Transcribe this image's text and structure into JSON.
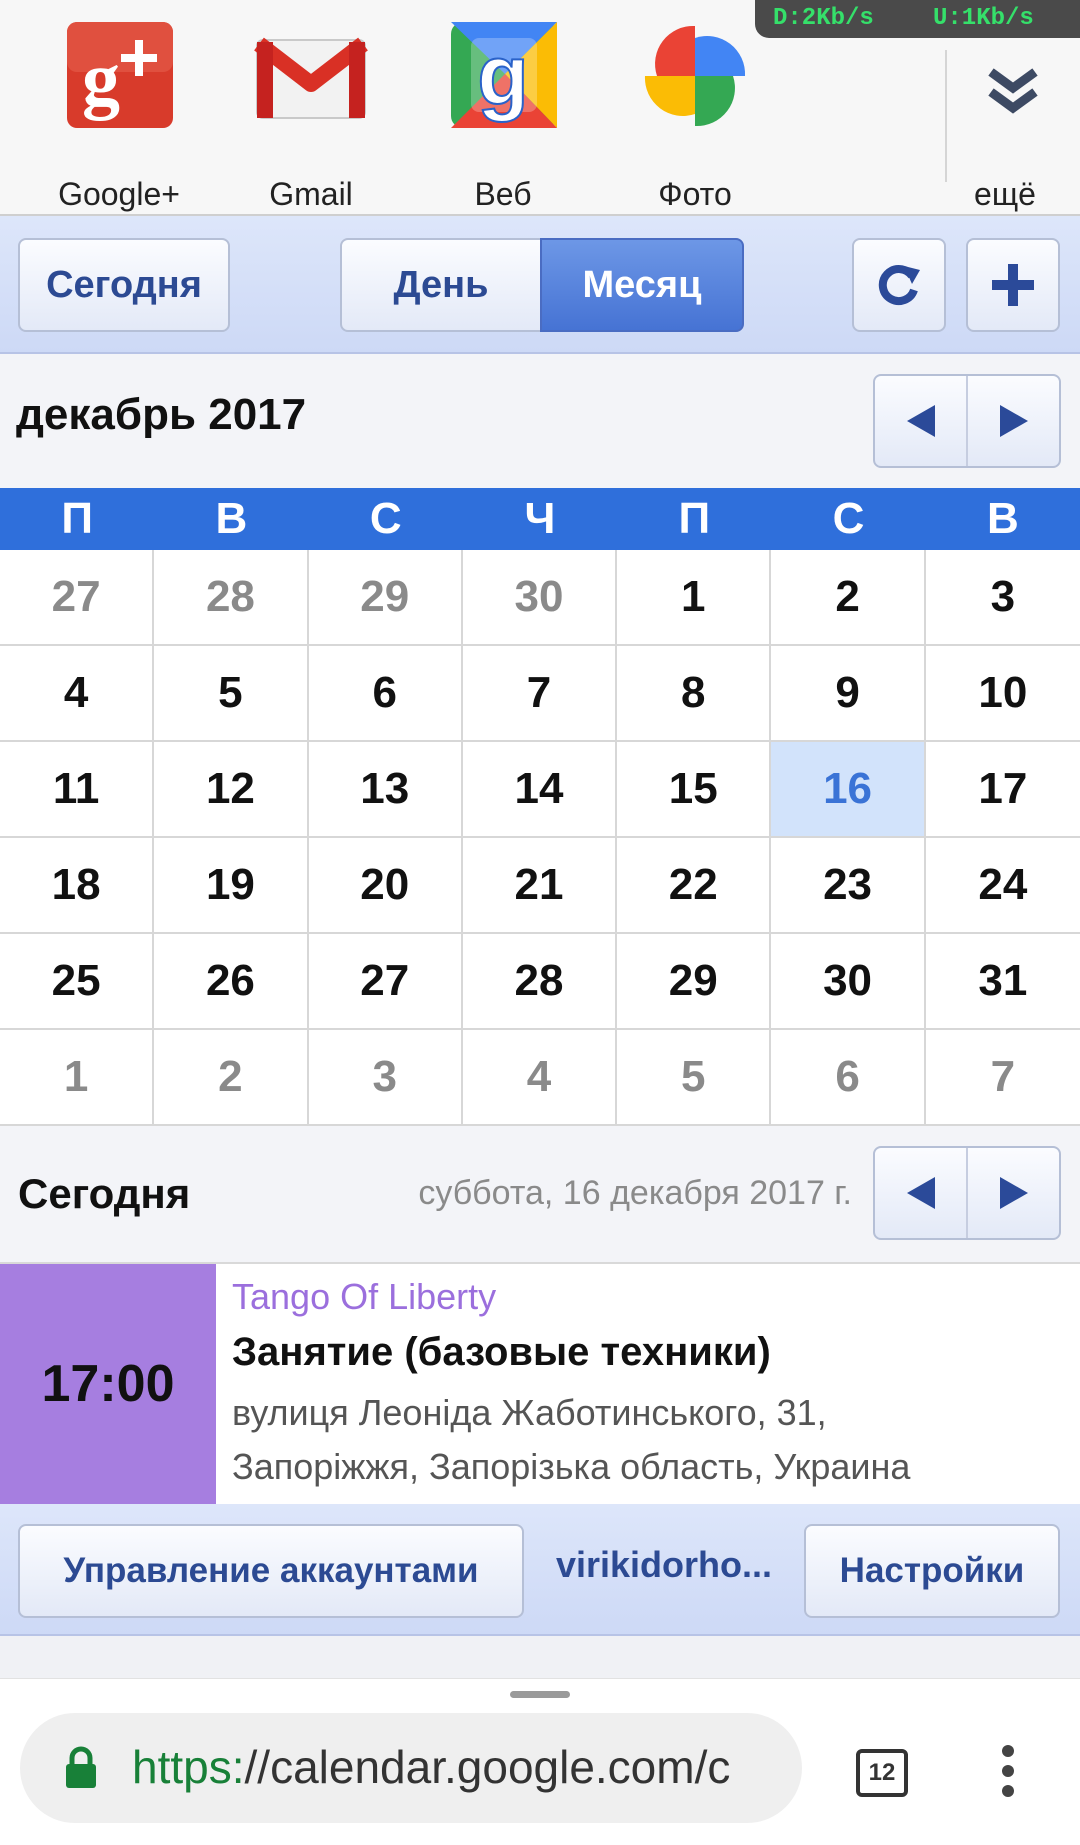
{
  "network_speed": {
    "download": "D:2Kb/s",
    "upload": "U:1Kb/s"
  },
  "apps": [
    {
      "label": "Google+",
      "icon": "google-plus-icon"
    },
    {
      "label": "Gmail",
      "icon": "gmail-icon"
    },
    {
      "label": "Веб",
      "icon": "google-web-icon"
    },
    {
      "label": "Фото",
      "icon": "google-photos-icon"
    }
  ],
  "more_label": "ещё",
  "toolbar": {
    "today": "Сегодня",
    "day": "День",
    "month": "Месяц",
    "refresh_icon": "refresh-icon",
    "add_icon": "plus-icon"
  },
  "month_title": "декабрь 2017",
  "weekdays": [
    "П",
    "В",
    "С",
    "Ч",
    "П",
    "С",
    "В"
  ],
  "days": [
    [
      "27",
      "28",
      "29",
      "30",
      "1",
      "2",
      "3"
    ],
    [
      "4",
      "5",
      "6",
      "7",
      "8",
      "9",
      "10"
    ],
    [
      "11",
      "12",
      "13",
      "14",
      "15",
      "16",
      "17"
    ],
    [
      "18",
      "19",
      "20",
      "21",
      "22",
      "23",
      "24"
    ],
    [
      "25",
      "26",
      "27",
      "28",
      "29",
      "30",
      "31"
    ],
    [
      "1",
      "2",
      "3",
      "4",
      "5",
      "6",
      "7"
    ]
  ],
  "today_section": {
    "label": "Сегодня",
    "date": "суббота, 16 декабря 2017 г."
  },
  "event": {
    "time": "17:00",
    "calendar": "Tango Of Liberty",
    "title": "Занятие (базовые техники)",
    "location_line1": "вулиця Леоніда Жаботинського, 31,",
    "location_line2": "Запоріжжя, Запорізька область, Украина",
    "color": "#a67ee0"
  },
  "account_bar": {
    "manage": "Управление аккаунтами",
    "email": "virikidorho...",
    "settings": "Настройки"
  },
  "browser": {
    "url_scheme": "https:",
    "url_rest": "//calendar.google.com/c",
    "tabs_count": "12"
  },
  "colors": {
    "accent": "#2f6fdb",
    "today_bg": "#d2e3fb",
    "url_green": "#188038"
  }
}
